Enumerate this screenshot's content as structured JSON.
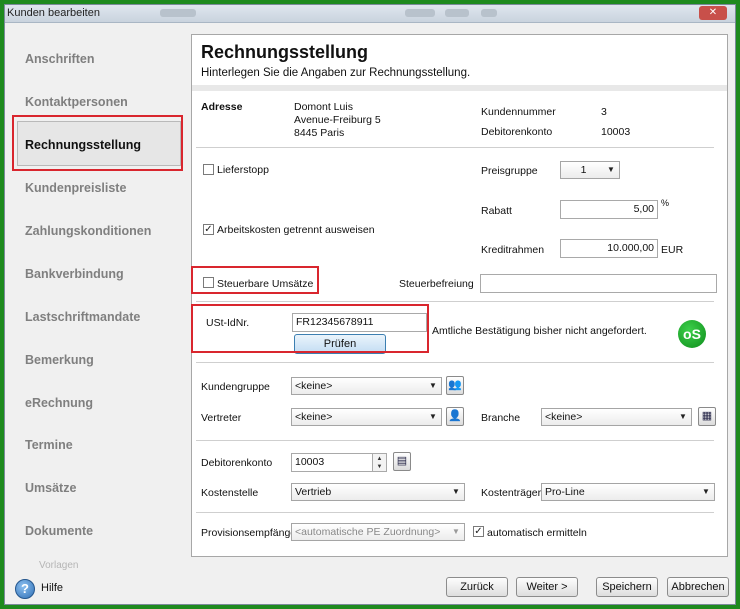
{
  "window": {
    "title": "Kunden bearbeiten",
    "close_icon": "close-icon"
  },
  "sidebar": {
    "items": [
      {
        "label": "Anschriften"
      },
      {
        "label": "Kontaktpersonen"
      },
      {
        "label": "Rechnungsstellung",
        "active": true
      },
      {
        "label": "Kundenpreisliste"
      },
      {
        "label": "Zahlungskonditionen"
      },
      {
        "label": "Bankverbindung"
      },
      {
        "label": "Lastschriftmandate"
      },
      {
        "label": "Bemerkung"
      },
      {
        "label": "eRechnung"
      },
      {
        "label": "Termine"
      },
      {
        "label": "Umsätze"
      },
      {
        "label": "Dokumente"
      },
      {
        "label": "Vorlagen"
      }
    ]
  },
  "panel": {
    "title": "Rechnungsstellung",
    "subtitle": "Hinterlegen Sie die Angaben zur Rechnungsstellung.",
    "address": {
      "label": "Adresse",
      "lines": [
        "Domont Luis",
        "Avenue-Freiburg 5",
        "8445 Paris"
      ]
    },
    "kundennummer": {
      "label": "Kundennummer",
      "value": "3"
    },
    "debitorenkonto_info": {
      "label": "Debitorenkonto",
      "value": "10003"
    },
    "lieferstopp": {
      "label": "Lieferstopp",
      "checked": false
    },
    "arbeitskosten": {
      "label": "Arbeitskosten getrennt ausweisen",
      "checked": true
    },
    "preisgruppe": {
      "label": "Preisgruppe",
      "value": "1"
    },
    "rabatt": {
      "label": "Rabatt",
      "value": "5,00",
      "unit": "%"
    },
    "kreditrahmen": {
      "label": "Kreditrahmen",
      "value": "10.000,00",
      "unit": "EUR"
    },
    "steuerbare": {
      "label": "Steuerbare Umsätze",
      "checked": false
    },
    "steuerbefreiung": {
      "label": "Steuerbefreiung",
      "value": ""
    },
    "ust": {
      "label": "USt-IdNr.",
      "value": "FR12345678911",
      "button": "Prüfen",
      "status": "Amtliche Bestätigung bisher nicht angefordert.",
      "badge": "oS"
    },
    "kundengruppe": {
      "label": "Kundengruppe",
      "value": "<keine>"
    },
    "vertreter": {
      "label": "Vertreter",
      "value": "<keine>"
    },
    "branche": {
      "label": "Branche",
      "value": "<keine>"
    },
    "debitorenkonto": {
      "label": "Debitorenkonto",
      "value": "10003"
    },
    "kostenstelle": {
      "label": "Kostenstelle",
      "value": "Vertrieb"
    },
    "kostentraeger": {
      "label": "Kostenträger",
      "value": "Pro-Line"
    },
    "provision": {
      "label": "Provisionsempfänge",
      "value": "<automatische PE Zuordnung>",
      "auto_label": "automatisch ermitteln",
      "auto_checked": true
    }
  },
  "footer": {
    "help": "Hilfe",
    "back": "Zurück",
    "next": "Weiter >",
    "save": "Speichern",
    "cancel": "Abbrechen"
  },
  "colors": {
    "highlight_red": "#d9262e",
    "background_green": "#1e8a1e",
    "primary_button": "#c3ddf3"
  }
}
